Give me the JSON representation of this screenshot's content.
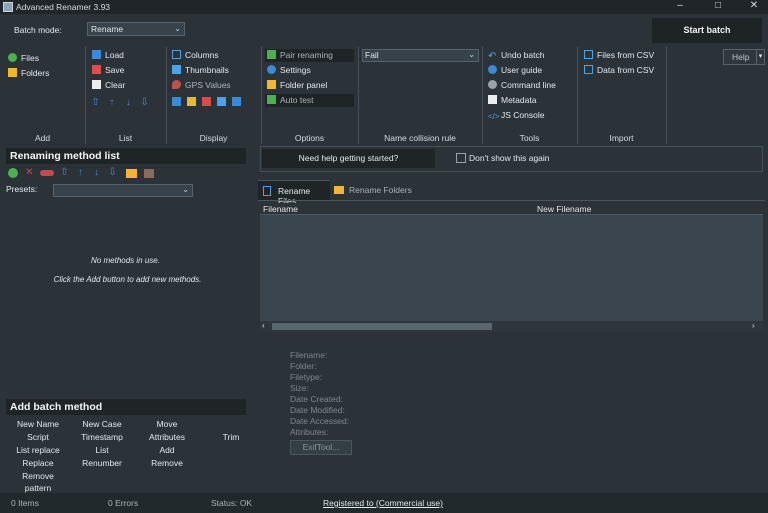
{
  "window": {
    "title": "Advanced Renamer 3.93",
    "min_icon": "minimize-icon",
    "max_icon": "maximize-icon",
    "close_icon": "close-icon"
  },
  "toolbar": {
    "batch_mode_label": "Batch mode:",
    "batch_mode_value": "Rename",
    "start_batch": "Start batch",
    "help": "Help"
  },
  "add_group": {
    "label": "Add",
    "items": [
      "Files",
      "Folders"
    ]
  },
  "list_group": {
    "label": "List",
    "items": [
      "Load",
      "Save",
      "Clear"
    ]
  },
  "display_group": {
    "label": "Display",
    "items": [
      "Columns",
      "Thumbnails",
      "GPS Values"
    ]
  },
  "options_group": {
    "label": "Options",
    "items": [
      "Pair renaming",
      "Settings",
      "Folder panel",
      "Auto test"
    ]
  },
  "collision_group": {
    "label": "Name collision rule",
    "value": "Fail"
  },
  "tools_group": {
    "label": "Tools",
    "items": [
      "Undo batch",
      "User guide",
      "Command line",
      "Metadata",
      "JS Console"
    ]
  },
  "import_group": {
    "label": "Import",
    "items": [
      "Files from CSV",
      "Data from CSV"
    ]
  },
  "method_list": {
    "title": "Renaming method list",
    "presets_label": "Presets:",
    "empty_line1": "No methods in use.",
    "empty_line2": "Click the Add button to add new methods."
  },
  "help_bar": {
    "button": "Need help getting started?",
    "checkbox": "Don't show this again"
  },
  "tabs": [
    "Rename Files",
    "Rename Folders"
  ],
  "table": {
    "columns": [
      "Filename",
      "New Filename"
    ]
  },
  "file_info": [
    "Filename:",
    "Folder:",
    "Filetype:",
    "Size:",
    "Date Created:",
    "Date Modified:",
    "Date Accessed:",
    "Attributes:"
  ],
  "exif_button": "ExifTool...",
  "add_batch": {
    "title": "Add batch method",
    "methods": [
      "New Name",
      "New Case",
      "Move",
      "Script",
      "Timestamp",
      "Attributes",
      "Trim",
      "List replace",
      "List",
      "Add",
      "Replace",
      "Renumber",
      "Remove",
      "Remove pattern"
    ]
  },
  "status": {
    "items": "0 Items",
    "errors": "0 Errors",
    "status": "Status: OK",
    "registered": "Registered to  (Commercial use)"
  }
}
